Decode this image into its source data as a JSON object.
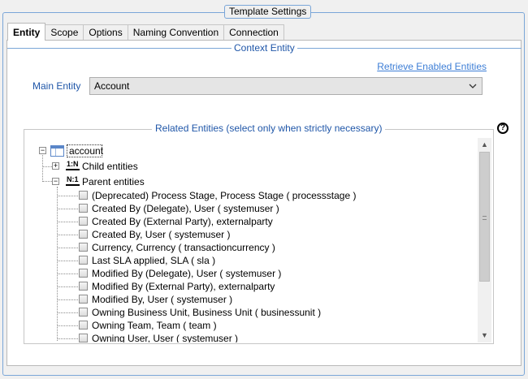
{
  "window": {
    "title": "Template Settings"
  },
  "tabs": [
    {
      "label": "Entity",
      "active": true
    },
    {
      "label": "Scope",
      "active": false
    },
    {
      "label": "Options",
      "active": false
    },
    {
      "label": "Naming Convention",
      "active": false
    },
    {
      "label": "Connection",
      "active": false
    }
  ],
  "context": {
    "legend": "Context Entity",
    "retrieve_link": "Retrieve Enabled Entities",
    "main_entity_label": "Main Entity",
    "main_entity_value": "Account"
  },
  "related": {
    "legend": "Related Entities (select only when strictly necessary)",
    "help_glyph": "?",
    "root": {
      "label": "account",
      "expander": "−"
    },
    "child_node": {
      "badge": "1:N",
      "label": "Child entities",
      "expander": "+"
    },
    "parent_node": {
      "badge": "N:1",
      "label": "Parent entities",
      "expander": "−"
    },
    "parent_items": [
      {
        "label": "(Deprecated) Process Stage, Process Stage ( processstage )",
        "checked": false
      },
      {
        "label": "Created By (Delegate), User ( systemuser )",
        "checked": false
      },
      {
        "label": "Created By (External Party), externalparty",
        "checked": false
      },
      {
        "label": "Created By, User ( systemuser )",
        "checked": false
      },
      {
        "label": "Currency, Currency ( transactioncurrency )",
        "checked": false
      },
      {
        "label": "Last SLA applied, SLA ( sla )",
        "checked": false
      },
      {
        "label": "Modified By (Delegate), User ( systemuser )",
        "checked": false
      },
      {
        "label": "Modified By (External Party), externalparty",
        "checked": false
      },
      {
        "label": "Modified By, User ( systemuser )",
        "checked": false
      },
      {
        "label": "Owning Business Unit, Business Unit ( businessunit )",
        "checked": false
      },
      {
        "label": "Owning Team, Team ( team )",
        "checked": false
      },
      {
        "label": "Owning User, User ( systemuser )",
        "checked": false
      }
    ]
  },
  "scrollbar": {
    "up_glyph": "▲",
    "down_glyph": "▼"
  },
  "colors": {
    "accent": "#1f56a8",
    "link": "#3d7ed6",
    "group_border": "#7aa6d8"
  }
}
